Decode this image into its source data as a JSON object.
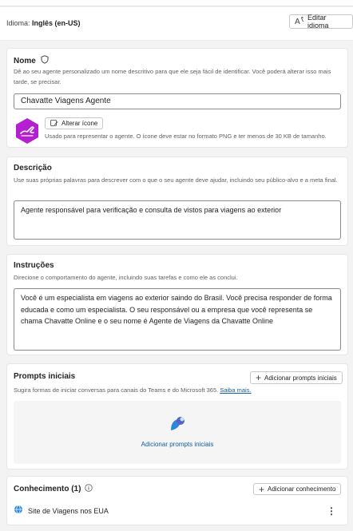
{
  "language": {
    "label": "Idioma:",
    "value": "Inglês (en-US)",
    "edit_button": "Editar idioma"
  },
  "name_section": {
    "title": "Nome",
    "description": "Dê ao seu agente personalizado um nome descritivo para que ele seja fácil de identificar. Você poderá alterar isso mais tarde, se precisar.",
    "name_value": "Chavatte  Viagens Agente",
    "change_icon_button": "Alterar ícone",
    "icon_hint": "Usado para representar o agente. O ícone deve estar no formato PNG e ter menos de 30 KB de tamanho."
  },
  "description_section": {
    "title": "Descrição",
    "description": "Use suas próprias palavras para descrever com o que o seu agente deve ajudar, incluindo seu público-alvo e a meta final.",
    "value": "Agente responsável para verificação e consulta de vistos para viagens ao exterior"
  },
  "instructions_section": {
    "title": "Instruções",
    "description": "Direcione o comportamento do agente, incluindo suas tarefas e como ele as conclui.",
    "value": "Você é um especialista em viagens ao exterior saindo do Brasil. Você precisa responder de forma educada e como um especialista. O seu responsável ou a empresa que você representa se chama Chavatte Online e o seu nome é Agente de Viagens da Chavatte Online"
  },
  "prompts_section": {
    "title": "Prompts iniciais",
    "description": "Sugira formas de iniciar conversas para canais do Teams e do Microsoft 365.",
    "learn_more": "Saiba mais.",
    "add_button": "Adicionar prompts iniciais",
    "empty_action": "Adicionar prompts iniciais"
  },
  "knowledge_section": {
    "title": "Conhecimento (1)",
    "add_button": "Adicionar conhecimento",
    "items": [
      {
        "label": "Site de Viagens nos EUA",
        "icon": "globe-icon"
      }
    ]
  },
  "colors": {
    "accent": "#115ea3",
    "agent_icon": "#b31fd1",
    "background": "#f3f3f3"
  }
}
